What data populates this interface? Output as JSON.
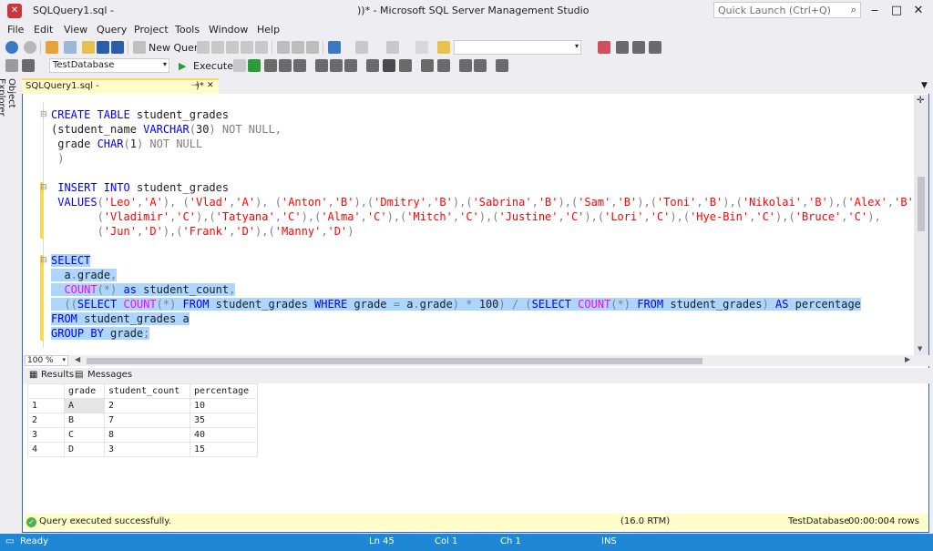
{
  "window": {
    "tab_title": "SQLQuery1.sql -",
    "title": "))* - Microsoft SQL Server Management Studio",
    "quick_launch_placeholder": "Quick Launch (Ctrl+Q)"
  },
  "menu": [
    "File",
    "Edit",
    "View",
    "Query",
    "Project",
    "Tools",
    "Window",
    "Help"
  ],
  "toolbar": {
    "new_query_label": "New Query",
    "database": "TestDatabase",
    "execute_label": "Execute"
  },
  "sidebar": {
    "object_explorer_label": "Object Explorer"
  },
  "doc_tab": {
    "title": "SQLQuery1.sql -",
    "suffix": ")*"
  },
  "editor": {
    "lines": [
      "CREATE TABLE student_grades",
      "(student_name VARCHAR(30) NOT NULL,",
      " grade CHAR(1) NOT NULL",
      " )",
      "",
      " INSERT INTO student_grades",
      " VALUES('Leo','A'), ('Vlad','A'), ('Anton','B'),('Dmitry','B'),('Sabrina','B'),('Sam','B'),('Toni','B'),('Nikolai','B'),('Alex','B'),",
      "       ('Vladimir','C'),('Tatyana','C'),('Alma','C'),('Mitch','C'),('Justine','C'),('Lori','C'),('Hye-Bin','C'),('Bruce','C'),",
      "       ('Jun','D'),('Frank','D'),('Manny','D')",
      "",
      "SELECT",
      "  a.grade,",
      "  COUNT(*) as student_count,",
      "  ((SELECT COUNT(*) FROM student_grades WHERE grade = a.grade) * 100) / (SELECT COUNT(*) FROM student_grades) AS percentage",
      "FROM student_grades a",
      "GROUP BY grade;"
    ],
    "zoom": "100 %"
  },
  "results": {
    "tabs": [
      "Results",
      "Messages"
    ],
    "columns": [
      "grade",
      "student_count",
      "percentage"
    ],
    "rows": [
      {
        "n": "1",
        "grade": "A",
        "count": "2",
        "pct": "10"
      },
      {
        "n": "2",
        "grade": "B",
        "count": "7",
        "pct": "35"
      },
      {
        "n": "3",
        "grade": "C",
        "count": "8",
        "pct": "40"
      },
      {
        "n": "4",
        "grade": "D",
        "count": "3",
        "pct": "15"
      }
    ]
  },
  "query_status": {
    "message": "Query executed successfully.",
    "server": "(16.0 RTM)",
    "database": "TestDatabase",
    "time": "00:00:00",
    "rows": "4 rows"
  },
  "statusbar": {
    "state": "Ready",
    "ln": "Ln 45",
    "col": "Col 1",
    "ch": "Ch 1",
    "mode": "INS"
  },
  "colors": {
    "accent": "#1e88d6",
    "selection": "#add6ff",
    "keyword": "#0000ff",
    "function": "#ff00ff",
    "string": "#ff0000"
  }
}
